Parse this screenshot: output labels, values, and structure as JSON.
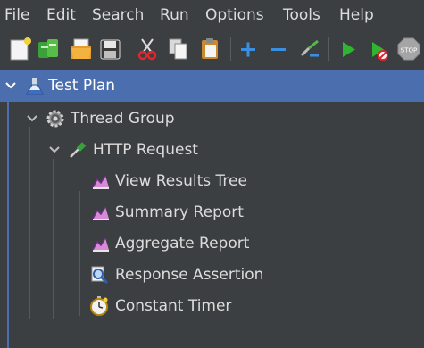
{
  "menu": {
    "file": {
      "mnemonic": "F",
      "rest": "ile"
    },
    "edit": {
      "mnemonic": "E",
      "rest": "dit"
    },
    "search": {
      "mnemonic": "S",
      "rest": "earch"
    },
    "run": {
      "mnemonic": "R",
      "rest": "un"
    },
    "options": {
      "mnemonic": "O",
      "rest": "ptions"
    },
    "tools": {
      "mnemonic": "T",
      "rest": "ools"
    },
    "help": {
      "mnemonic": "H",
      "rest": "elp"
    }
  },
  "toolbar": {
    "icons": [
      "new-icon",
      "templates-icon",
      "open-icon",
      "save-icon",
      "cut-icon",
      "copy-icon",
      "paste-icon",
      "expand-icon",
      "collapse-icon",
      "toggle-icon",
      "start-icon",
      "start-no-timers-icon",
      "stop-icon"
    ],
    "stop_label": "STOP"
  },
  "tree": {
    "test_plan": "Test Plan",
    "thread_group": "Thread Group",
    "http_request": "HTTP Request",
    "children": [
      {
        "label": "View Results Tree",
        "icon": "listener-chart-icon"
      },
      {
        "label": "Summary Report",
        "icon": "listener-chart-icon"
      },
      {
        "label": "Aggregate Report",
        "icon": "listener-chart-icon"
      },
      {
        "label": "Response Assertion",
        "icon": "assertion-magnifier-icon"
      },
      {
        "label": "Constant Timer",
        "icon": "timer-stopwatch-icon"
      }
    ]
  },
  "colors": {
    "background": "#3c3f41",
    "selection": "#4b6eaf",
    "text": "#dcdcdc"
  }
}
